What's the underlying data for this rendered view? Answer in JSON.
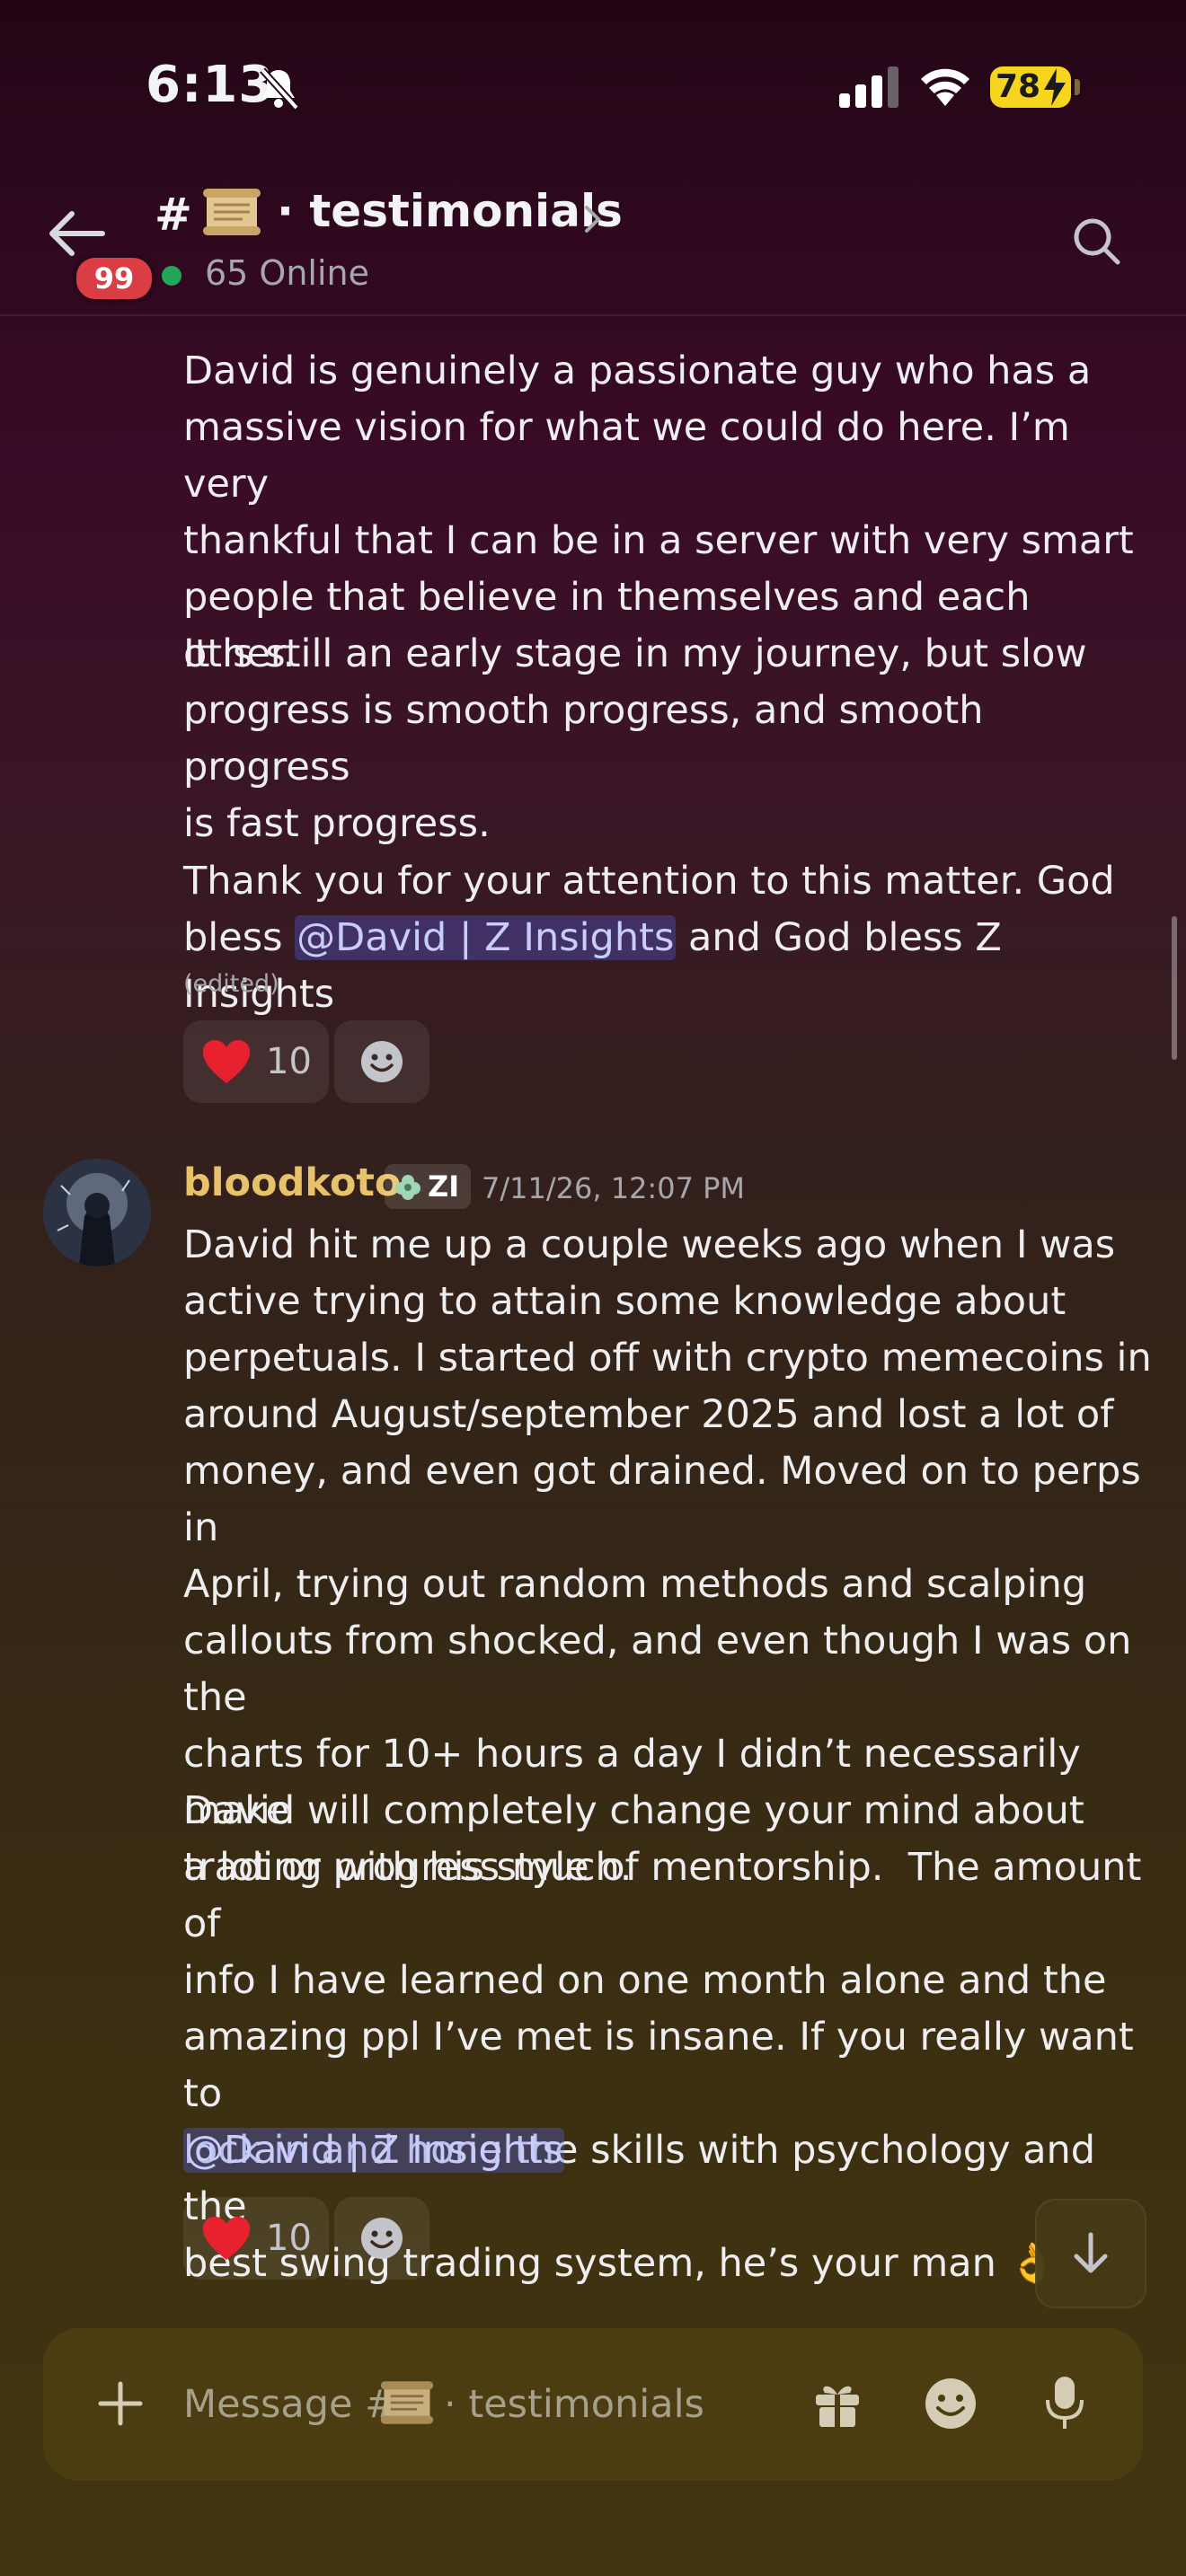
{
  "status_bar": {
    "time": "6:13",
    "battery": "78"
  },
  "header": {
    "unread_badge": "99",
    "hash": "#",
    "channel_name": "· testimonials",
    "online": "65 Online"
  },
  "messages": [
    {
      "paragraphs": [
        "David is genuinely a passionate guy who has a\nmassive vision for what we could do here. I’m very\nthankful that I can be in a server with very smart\npeople that believe in themselves and each other.",
        "It is still an early stage in my journey, but slow\nprogress is smooth progress, and smooth progress\nis fast progress."
      ],
      "closing_before": "Thank you for your attention to this matter. God\nbless ",
      "mention": "@David | Z Insights",
      "closing_after": " and God bless Z Insights",
      "edited": "(edited)",
      "reaction_count": "10"
    },
    {
      "username": "bloodkoto",
      "role_tag": "ZI",
      "timestamp": "7/11/26, 12:07 PM",
      "paragraphs": [
        "David hit me up a couple weeks ago when I was\nactive trying to attain some knowledge about\nperpetuals. I started off with crypto memecoins in\naround August/september 2025 and lost a lot of\nmoney, and even got drained. Moved on to perps in\nApril, trying out random methods and scalping\ncallouts from shocked, and even though I was on the\ncharts for 10+ hours a day I didn’t necessarily make\na lot or progress much.",
        "David will completely change your mind about\ntrading with his style of mentorship.  The amount of\ninfo I have learned on one month alone and the\namazing ppl I’ve met is insane. If you really want to\nlock in and hone the skills with psychology and the\nbest swing trading system, he’s your man 👌"
      ],
      "mention": "@David | Z Insights",
      "reaction_count": "10"
    }
  ],
  "composer": {
    "placeholder_prefix": "Message #",
    "placeholder_channel": "· testimonials"
  },
  "colors": {
    "mention_bg": "#3b3f7a",
    "username": "#e8c16b",
    "online_dot": "#23a55a",
    "badge": "#da3e44",
    "battery": "#f7d51d"
  },
  "icons": [
    "bell-slash-icon",
    "signal-icon",
    "wifi-icon",
    "back-arrow-icon",
    "search-icon",
    "heart-icon",
    "add-reaction-icon",
    "arrow-down-icon",
    "plus-icon",
    "gift-icon",
    "emoji-icon",
    "mic-icon"
  ]
}
